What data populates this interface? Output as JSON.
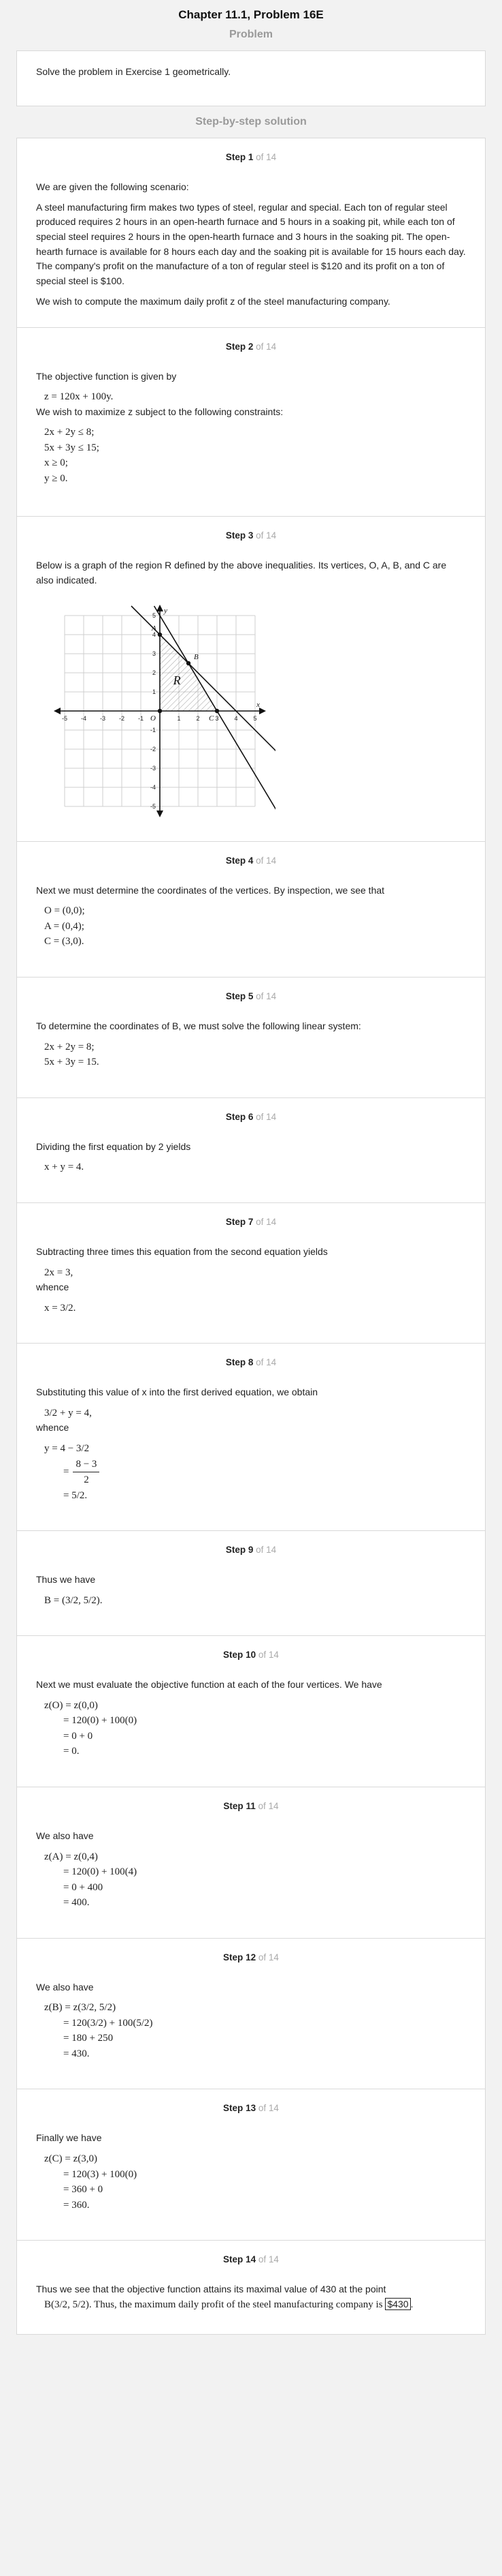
{
  "header": {
    "title": "Chapter 11.1, Problem 16E"
  },
  "problem": {
    "section_label": "Problem",
    "text": "Solve the problem in Exercise 1 geometrically."
  },
  "solution": {
    "section_label": "Step-by-step solution",
    "total": "14",
    "of_word": "of",
    "step_word": "Step"
  },
  "steps": {
    "s1": {
      "num": "1",
      "p1": "We are given the following scenario:",
      "p2": "A steel manufacturing firm makes two types of steel, regular and special. Each ton of regular steel produced requires 2 hours in an open-hearth furnace and 5 hours in a soaking pit, while each ton of special steel requires 2 hours in the open-hearth furnace and 3 hours in the soaking pit. The open-hearth furnace is available for 8 hours each day and the soaking pit is available for 15 hours each day. The company's profit on the manufacture of a ton of regular steel is $120 and its profit on a ton of special steel is $100.",
      "p3": "We wish to compute the maximum daily profit z of the steel manufacturing company."
    },
    "s2": {
      "num": "2",
      "p1": "The objective function is given by",
      "m1": "z = 120x + 100y.",
      "p2": "We wish to maximize z subject to the following constraints:",
      "c1": "2x + 2y ≤ 8;",
      "c2": "5x + 3y ≤ 15;",
      "c3": "x ≥ 0;",
      "c4": "y ≥ 0."
    },
    "s3": {
      "num": "3",
      "p1": "Below is a graph of the region R defined by the above inequalities. Its vertices, O, A, B, and C are also indicated."
    },
    "s4": {
      "num": "4",
      "p1": "Next we must determine the coordinates of the vertices. By inspection, we see that",
      "m1": "O = (0,0);",
      "m2": "A = (0,4);",
      "m3": "C = (3,0)."
    },
    "s5": {
      "num": "5",
      "p1": "To determine the coordinates of B, we must solve the following linear system:",
      "m1": "2x + 2y = 8;",
      "m2": "5x + 3y = 15."
    },
    "s6": {
      "num": "6",
      "p1": "Dividing the first equation by 2 yields",
      "m1": "x + y = 4."
    },
    "s7": {
      "num": "7",
      "p1": "Subtracting three times this equation from the second equation yields",
      "m1": "2x = 3,",
      "p2": "whence",
      "m2": "x = 3/2."
    },
    "s8": {
      "num": "8",
      "p1": "Substituting this value of x into the first derived equation, we obtain",
      "m1": "3/2 + y = 4,",
      "p2": "whence",
      "m2": "y = 4 − 3/2",
      "m3_num": "8 − 3",
      "m3_den": "2",
      "m4": "= 5/2."
    },
    "s9": {
      "num": "9",
      "p1": "Thus we have",
      "m1": "B = (3/2, 5/2)."
    },
    "s10": {
      "num": "10",
      "p1": "Next we must evaluate the objective function at each of the four vertices. We have",
      "m1": "z(O) = z(0,0)",
      "m2": "= 120(0) + 100(0)",
      "m3": "= 0 + 0",
      "m4": "= 0."
    },
    "s11": {
      "num": "11",
      "p1": "We also have",
      "m1": "z(A) = z(0,4)",
      "m2": "= 120(0) + 100(4)",
      "m3": "= 0 + 400",
      "m4": "= 400."
    },
    "s12": {
      "num": "12",
      "p1": "We also have",
      "m1": "z(B) = z(3/2, 5/2)",
      "m2": "= 120(3/2) + 100(5/2)",
      "m3": "= 180 + 250",
      "m4": "= 430."
    },
    "s13": {
      "num": "13",
      "p1": "Finally we have",
      "m1": "z(C) = z(3,0)",
      "m2": "= 120(3) + 100(0)",
      "m3": "= 360 + 0",
      "m4": "= 360."
    },
    "s14": {
      "num": "14",
      "p1a": "Thus we see that the objective function attains its maximal value of 430 at the point",
      "p1b": "B(3/2, 5/2). Thus, the maximum daily profit of the steel manufacturing company is",
      "answer": "$430",
      "p1c": "."
    }
  },
  "graph": {
    "xlim": [
      -5,
      5
    ],
    "ylim": [
      -5,
      5
    ],
    "axis_x": "x",
    "axis_y": "y",
    "region_label": "R",
    "vertices": [
      {
        "label": "O",
        "x": 0,
        "y": 0
      },
      {
        "label": "A",
        "x": 0,
        "y": 4
      },
      {
        "label": "B",
        "x": 1.5,
        "y": 2.5
      },
      {
        "label": "C",
        "x": 3,
        "y": 0
      }
    ],
    "lines": [
      {
        "a": 2,
        "b": 2,
        "c": 8
      },
      {
        "a": 5,
        "b": 3,
        "c": 15
      }
    ],
    "x_ticks": [
      "-5",
      "-4",
      "-3",
      "-2",
      "-1",
      "1",
      "2",
      "3",
      "4",
      "5"
    ],
    "y_ticks": [
      "5",
      "4",
      "3",
      "2",
      "1",
      "-1",
      "-2",
      "-3",
      "-4",
      "-5"
    ]
  }
}
